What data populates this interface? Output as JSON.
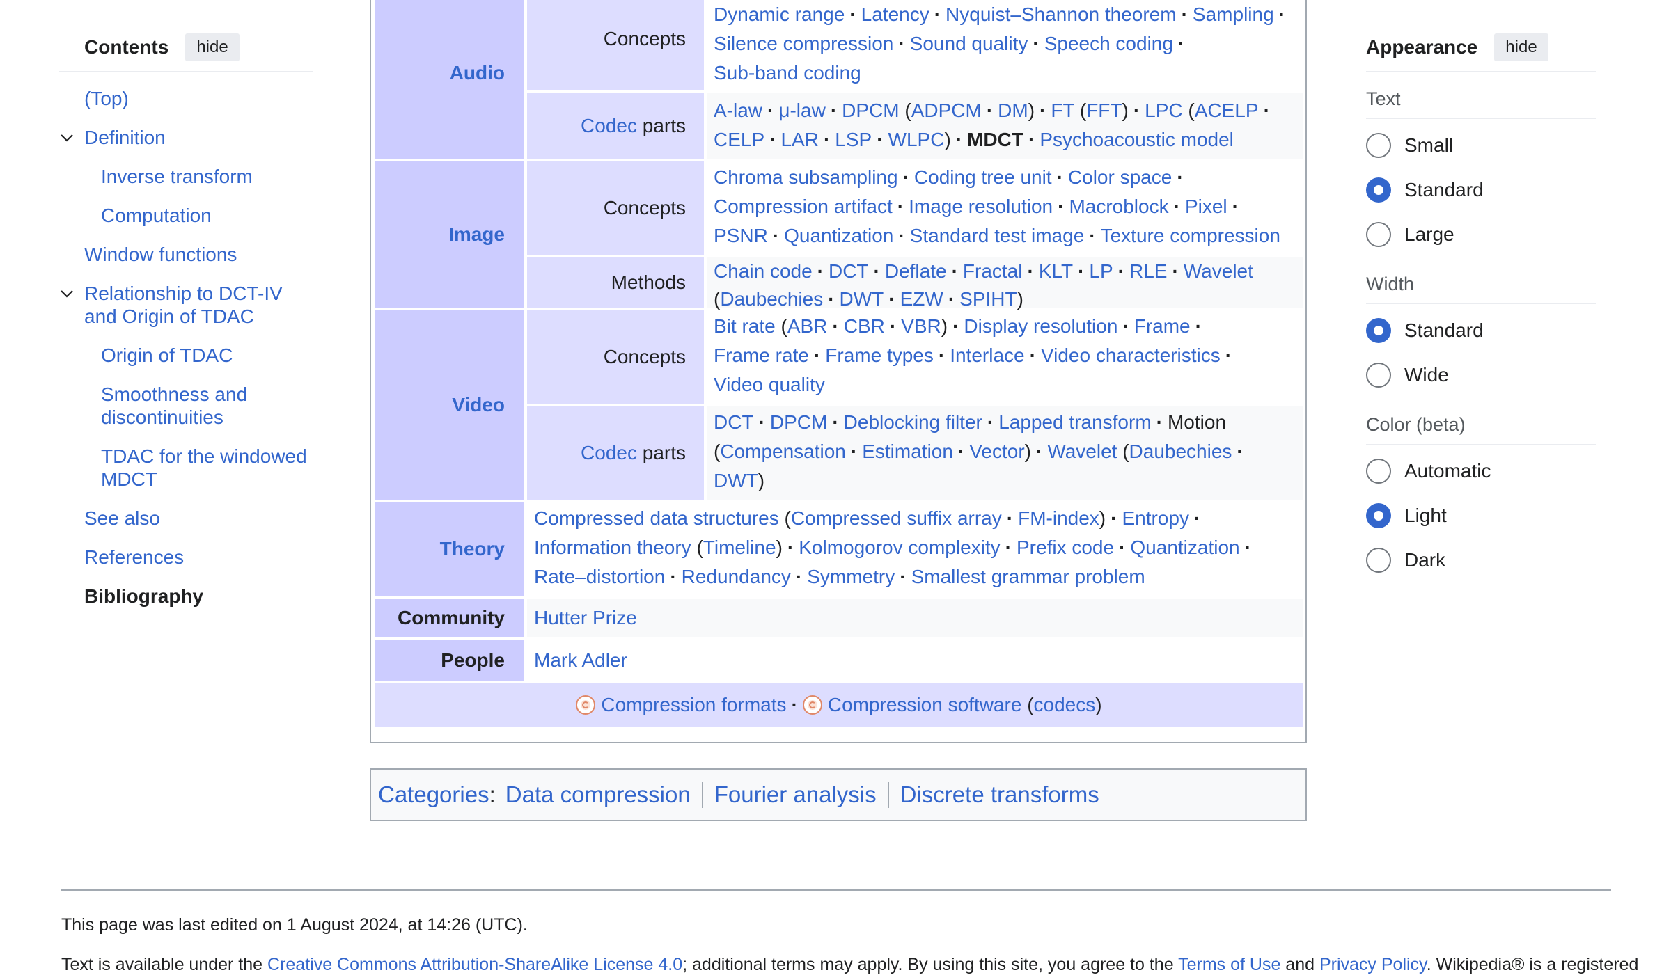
{
  "toc": {
    "title": "Contents",
    "hide_label": "hide",
    "items": [
      {
        "label": "(Top)"
      },
      {
        "label": "Definition"
      },
      {
        "label": "Inverse transform"
      },
      {
        "label": "Computation"
      },
      {
        "label": "Window functions"
      },
      {
        "label": "Relationship to DCT-IV and Origin of TDAC"
      },
      {
        "label": "Origin of TDAC"
      },
      {
        "label": "Smoothness and discontinuities"
      },
      {
        "label": "TDAC for the windowed MDCT"
      },
      {
        "label": "See also"
      },
      {
        "label": "References"
      },
      {
        "label": "Bibliography"
      }
    ]
  },
  "appearance": {
    "title": "Appearance",
    "hide_label": "hide",
    "text_group": {
      "title": "Text",
      "options": [
        "Small",
        "Standard",
        "Large"
      ],
      "selected": "Standard"
    },
    "width_group": {
      "title": "Width",
      "options": [
        "Standard",
        "Wide"
      ],
      "selected": "Standard"
    },
    "color_group": {
      "title": "Color (beta)",
      "options": [
        "Automatic",
        "Light",
        "Dark"
      ],
      "selected": "Light"
    }
  },
  "navbox": {
    "groups": {
      "audio": "Audio",
      "image": "Image",
      "video": "Video",
      "theory": "Theory",
      "community": "Community",
      "people": "People"
    },
    "subgroups": {
      "concepts": "Concepts",
      "codec": "Codec",
      "parts": "parts",
      "methods": "Methods"
    },
    "audio_concepts": [
      "Dynamic range",
      "Latency",
      "Nyquist–Shannon theorem",
      "Sampling",
      "Silence compression",
      "Sound quality",
      "Speech coding",
      "Sub-band coding"
    ],
    "audio_codec": {
      "alaw": "A-law",
      "mulaw": "μ-law",
      "dpcm": "DPCM",
      "adpcm": "ADPCM",
      "dm": "DM",
      "ft": "FT",
      "fft": "FFT",
      "lpc": "LPC",
      "acelp": "ACELP",
      "celp": "CELP",
      "lar": "LAR",
      "lsp": "LSP",
      "wlpc": "WLPC",
      "mdct": "MDCT",
      "psycho": "Psychoacoustic model"
    },
    "image_concepts": [
      "Chroma subsampling",
      "Coding tree unit",
      "Color space",
      "Compression artifact",
      "Image resolution",
      "Macroblock",
      "Pixel",
      "PSNR",
      "Quantization",
      "Standard test image",
      "Texture compression"
    ],
    "image_methods": {
      "chain": "Chain code",
      "dct": "DCT",
      "deflate": "Deflate",
      "fractal": "Fractal",
      "klt": "KLT",
      "lp": "LP",
      "rle": "RLE",
      "wavelet": "Wavelet",
      "daub": "Daubechies",
      "dwt": "DWT",
      "ezw": "EZW",
      "spiht": "SPIHT"
    },
    "video_concepts": {
      "bitrate": "Bit rate",
      "abr": "ABR",
      "cbr": "CBR",
      "vbr": "VBR",
      "display": "Display resolution",
      "frame": "Frame",
      "framerate": "Frame rate",
      "frametypes": "Frame types",
      "interlace": "Interlace",
      "videochar": "Video characteristics",
      "videoquality": "Video quality"
    },
    "video_codec": {
      "dct": "DCT",
      "dpcm": "DPCM",
      "deblock": "Deblocking filter",
      "lapped": "Lapped transform",
      "motion": "Motion",
      "compensation": "Compensation",
      "estimation": "Estimation",
      "vector": "Vector",
      "wavelet": "Wavelet",
      "daub": "Daubechies",
      "dwt": "DWT"
    },
    "theory": {
      "cds": "Compressed data structures",
      "csa": "Compressed suffix array",
      "fmi": "FM-index",
      "entropy": "Entropy",
      "info": "Information theory",
      "timeline": "Timeline",
      "kolmo": "Kolmogorov complexity",
      "prefix": "Prefix code",
      "quant": "Quantization",
      "rd": "Rate–distortion",
      "redund": "Redundancy",
      "symmetry": "Symmetry",
      "sgp": "Smallest grammar problem"
    },
    "community_items": [
      "Hutter Prize"
    ],
    "people_items": [
      "Mark Adler"
    ],
    "footer": {
      "formats": "Compression formats",
      "software": "Compression software",
      "codecs": "codecs"
    }
  },
  "categories": {
    "label": "Categories",
    "items": [
      "Data compression",
      "Fourier analysis",
      "Discrete transforms"
    ]
  },
  "footer": {
    "last_edited": "This page was last edited on 1 August 2024, at 14:26 (UTC).",
    "license_pre": "Text is available under the ",
    "license_link": "Creative Commons Attribution-ShareAlike License 4.0",
    "license_mid": "; additional terms may apply. By using this site, you agree to the ",
    "terms_link": "Terms of Use",
    "and": " and ",
    "privacy_link": "Privacy Policy",
    "license_post": ". Wikipedia® is a registered"
  },
  "colors": {
    "link": "#3366cc",
    "group_bg": "#ccccff",
    "subgroup_bg": "#ddddff",
    "even_row": "#f8f9fa",
    "radio_selected": "#3366cc"
  },
  "icons": [
    "chevron-down-icon",
    "radio-icon",
    "compression-logo-icon"
  ]
}
